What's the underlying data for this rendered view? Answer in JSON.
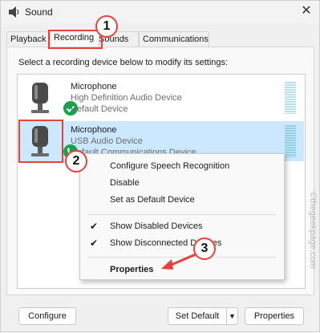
{
  "window": {
    "title": "Sound",
    "close_glyph": "✕"
  },
  "tabs": [
    {
      "label": "Playback"
    },
    {
      "label": "Recording"
    },
    {
      "label": "Sounds"
    },
    {
      "label": "Communications"
    }
  ],
  "instruction": "Select a recording device below to modify its settings:",
  "devices": [
    {
      "name": "Microphone",
      "description": "High Definition Audio Device",
      "status": "Default Device",
      "badge": "check-icon"
    },
    {
      "name": "Microphone",
      "description": "USB Audio Device",
      "status": "Default Communications Device",
      "badge": "phone-icon"
    }
  ],
  "context_menu": {
    "items": [
      {
        "label": "Configure Speech Recognition",
        "checked": false,
        "bold": false
      },
      {
        "label": "Disable",
        "checked": false,
        "bold": false
      },
      {
        "label": "Set as Default Device",
        "checked": false,
        "bold": false
      },
      {
        "label": "Show Disabled Devices",
        "checked": true,
        "bold": false
      },
      {
        "label": "Show Disconnected Devices",
        "checked": true,
        "bold": false
      },
      {
        "label": "Properties",
        "checked": false,
        "bold": true
      }
    ],
    "check_glyph": "✔"
  },
  "buttons": {
    "configure": "Configure",
    "set_default": "Set Default",
    "set_default_arrow": "▼",
    "properties": "Properties"
  },
  "annotations": {
    "step1": "1",
    "step2": "2",
    "step3": "3"
  },
  "watermark": "©thegeekpage.com",
  "colors": {
    "annotation_red": "#e8413a",
    "selection_blue": "#cce8ff",
    "status_green": "#16a34a"
  }
}
